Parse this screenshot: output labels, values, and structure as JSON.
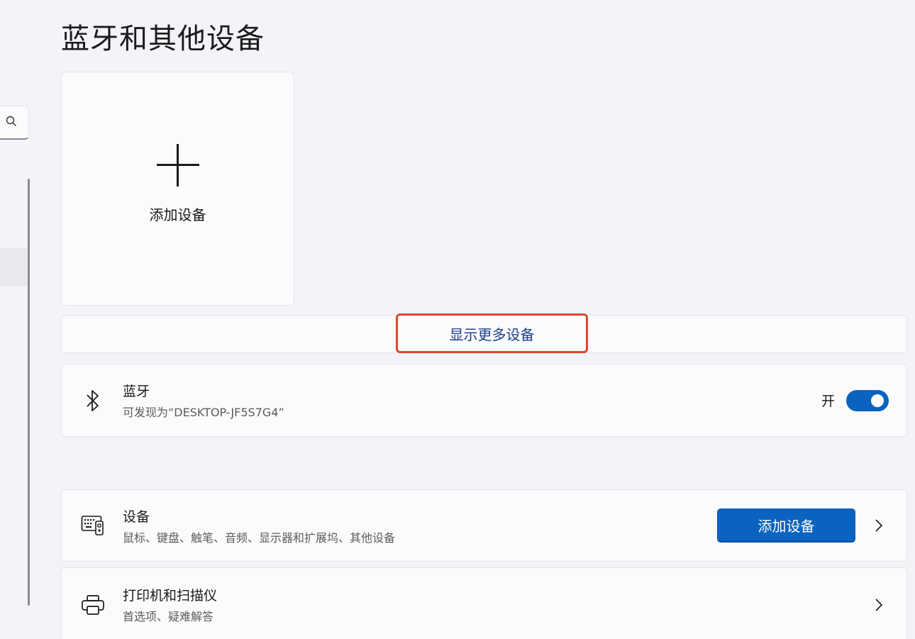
{
  "page": {
    "title": "蓝牙和其他设备"
  },
  "add_tile": {
    "label": "添加设备"
  },
  "show_more": {
    "label": "显示更多设备"
  },
  "bluetooth": {
    "title": "蓝牙",
    "subtitle": "可发现为“DESKTOP-JF5S7G4”",
    "toggle_state_label": "开",
    "toggle_on": true
  },
  "devices": {
    "title": "设备",
    "subtitle": "鼠标、键盘、触笔、音频、显示器和扩展坞、其他设备",
    "button_label": "添加设备"
  },
  "printers": {
    "title": "打印机和扫描仪",
    "subtitle": "首选项、疑难解答"
  },
  "colors": {
    "accent": "#0a63bf",
    "highlight_border": "#e0452d",
    "link_text": "#1c3f8c"
  },
  "icons": [
    "search-icon",
    "plus-icon",
    "bluetooth-icon",
    "keyboard-device-icon",
    "printer-icon",
    "chevron-right-icon"
  ]
}
